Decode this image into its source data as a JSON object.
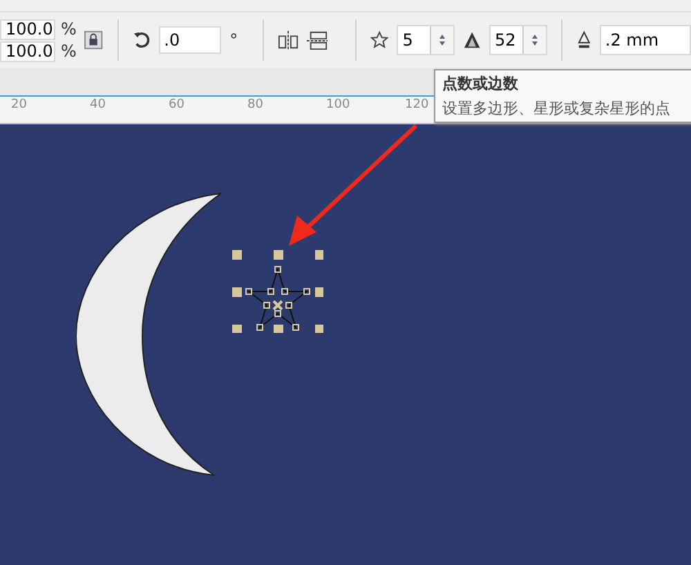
{
  "property_bar": {
    "scale_x": {
      "value": "100.0",
      "unit": "%"
    },
    "scale_y": {
      "value": "100.0",
      "unit": "%"
    },
    "rotation": {
      "value": ".0",
      "unit": "°"
    },
    "points": {
      "value": "5"
    },
    "sharpness": {
      "value": "52"
    },
    "outline_width": {
      "value": ".2 mm"
    }
  },
  "ruler": {
    "labels": [
      "20",
      "40",
      "60",
      "80",
      "100",
      "120"
    ]
  },
  "tooltip": {
    "title": "点数或边数",
    "text": "设置多边形、星形或复杂星形的点"
  }
}
